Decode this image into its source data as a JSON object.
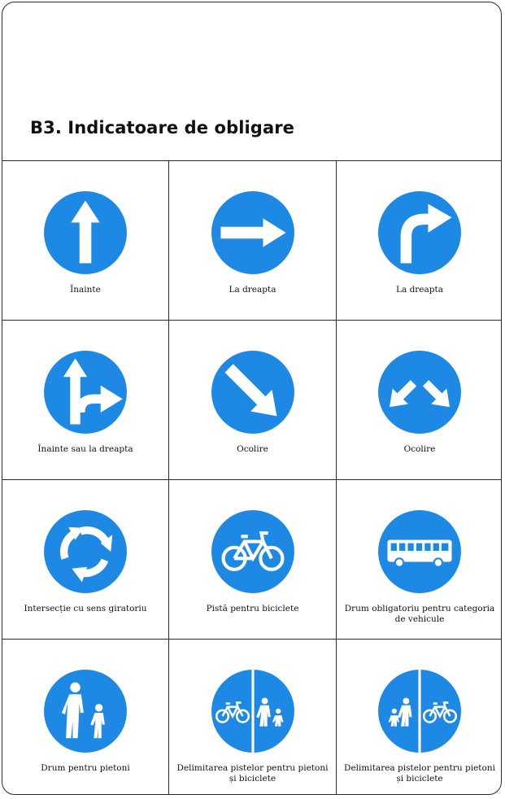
{
  "page": {
    "title": "B3. Indicatoare de obligare"
  },
  "colors": {
    "sign_blue": "#1e88e5",
    "sign_white": "#ffffff"
  },
  "signs": [
    {
      "icon": "arrow-up-icon",
      "label": "Înainte"
    },
    {
      "icon": "arrow-right-icon",
      "label": "La dreapta"
    },
    {
      "icon": "turn-right-icon",
      "label": "La dreapta"
    },
    {
      "icon": "straight-or-right-icon",
      "label": "Înainte sau la dreapta"
    },
    {
      "icon": "keep-right-icon",
      "label": "Ocolire"
    },
    {
      "icon": "pass-either-side-icon",
      "label": "Ocolire"
    },
    {
      "icon": "roundabout-icon",
      "label": "Intersecție cu sens giratoriu"
    },
    {
      "icon": "bicycle-icon",
      "label": "Pistă pentru biciclete"
    },
    {
      "icon": "bus-icon",
      "label": "Drum obligatoriu pentru categoria de vehicule"
    },
    {
      "icon": "pedestrians-icon",
      "label": "Drum pentru pietoni"
    },
    {
      "icon": "bicycle-pedestrian-split-icon",
      "label": "Delimitarea pistelor pentru pietoni și biciclete"
    },
    {
      "icon": "pedestrian-bicycle-split-icon",
      "label": "Delimitarea pistelor pentru pietoni și biciclete"
    }
  ]
}
